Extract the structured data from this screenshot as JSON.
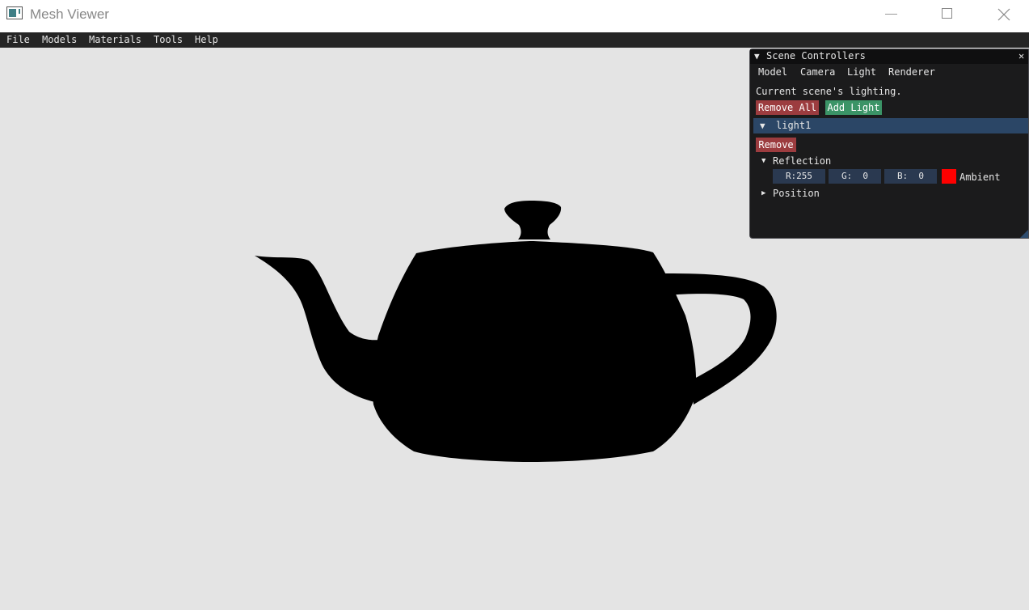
{
  "window": {
    "title": "Mesh Viewer"
  },
  "menubar": {
    "items": [
      "File",
      "Models",
      "Materials",
      "Tools",
      "Help"
    ]
  },
  "panel": {
    "title": "Scene Controllers",
    "close_glyph": "✕",
    "tabs": [
      "Model",
      "Camera",
      "Light",
      "Renderer"
    ],
    "description": "Current scene's lighting.",
    "remove_all_label": "Remove All",
    "add_light_label": "Add Light",
    "light": {
      "name": "light1",
      "remove_label": "Remove",
      "reflection": {
        "label": "Reflection",
        "r": "R:255",
        "g": "G:  0",
        "b": "B:  0",
        "type_label": "Ambient",
        "color": "#ff0000"
      },
      "position_label": "Position"
    }
  },
  "colors": {
    "viewport_bg": "#e4e4e4",
    "model_fill": "#000000",
    "remove_button": "#9c3c3f",
    "add_button": "#3b9467",
    "header_highlight": "#2b4666"
  },
  "icons": {
    "app": "app-window-icon",
    "minimize": "minimize-icon",
    "maximize": "maximize-icon",
    "close": "close-icon"
  }
}
